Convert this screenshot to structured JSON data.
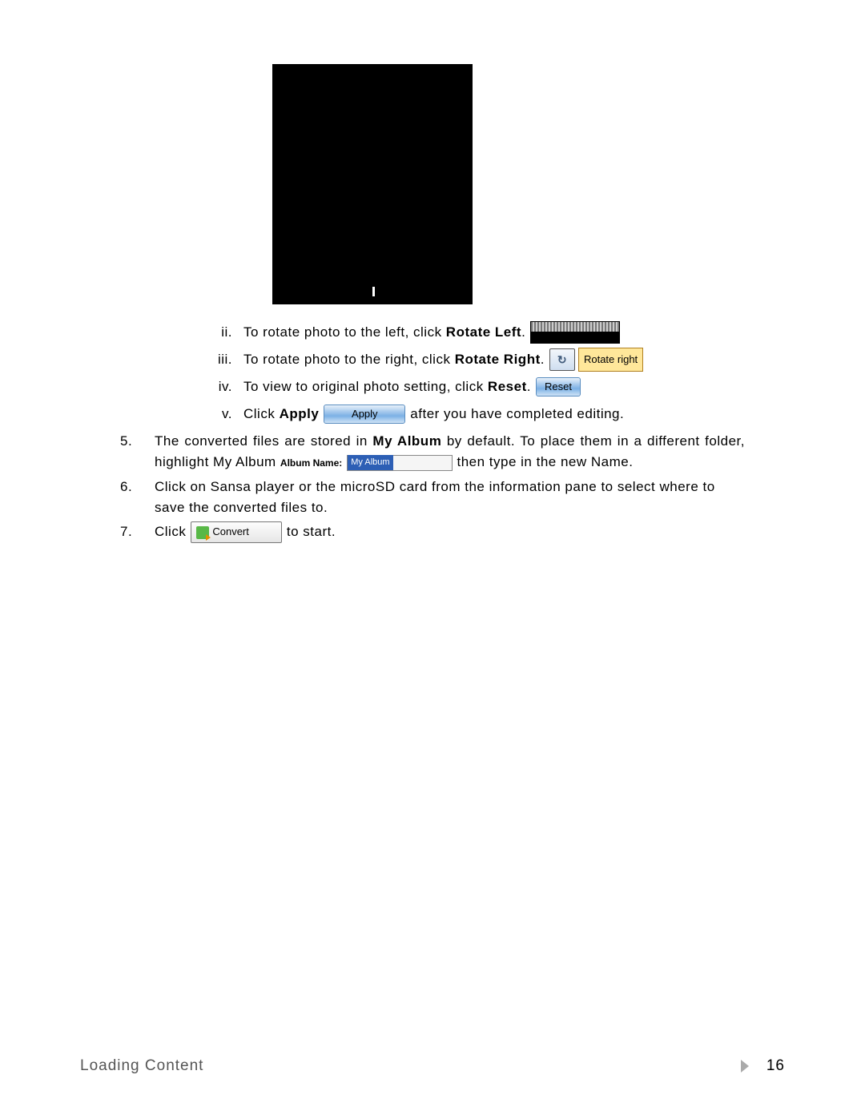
{
  "roman": {
    "ii": {
      "num": "ii.",
      "pre": "To rotate photo to the left, click ",
      "bold": "Rotate Left",
      "post": "."
    },
    "iii": {
      "num": "iii.",
      "pre": "To rotate photo to the right, click ",
      "bold": "Rotate Right",
      "post": "."
    },
    "iv": {
      "num": "iv.",
      "pre": "To view to original photo setting, click ",
      "bold": "Reset",
      "post": "."
    },
    "v": {
      "num": "v.",
      "pre": "Click ",
      "bold": "Apply",
      "post": " after you have completed editing."
    }
  },
  "top": {
    "five": {
      "num": "5.",
      "a": "The converted files are stored in ",
      "b": "My Album",
      "c": " by default.  To place them in a different folder, highlight My Album ",
      "d": " then type in the new Name."
    },
    "six": {
      "num": "6.",
      "text": "Click on Sansa player or the microSD card from the information pane to select where to save the converted files to."
    },
    "seven": {
      "num": "7.",
      "pre": "Click ",
      "post": " to start."
    }
  },
  "buttons": {
    "reset": "Reset",
    "apply": "Apply",
    "rotate_right": "Rotate right",
    "rotate_symbol": "↻",
    "album_label": "Album Name:",
    "album_value": "My Album",
    "convert": "Convert"
  },
  "footer": {
    "left": "Loading Content",
    "page": "16"
  }
}
